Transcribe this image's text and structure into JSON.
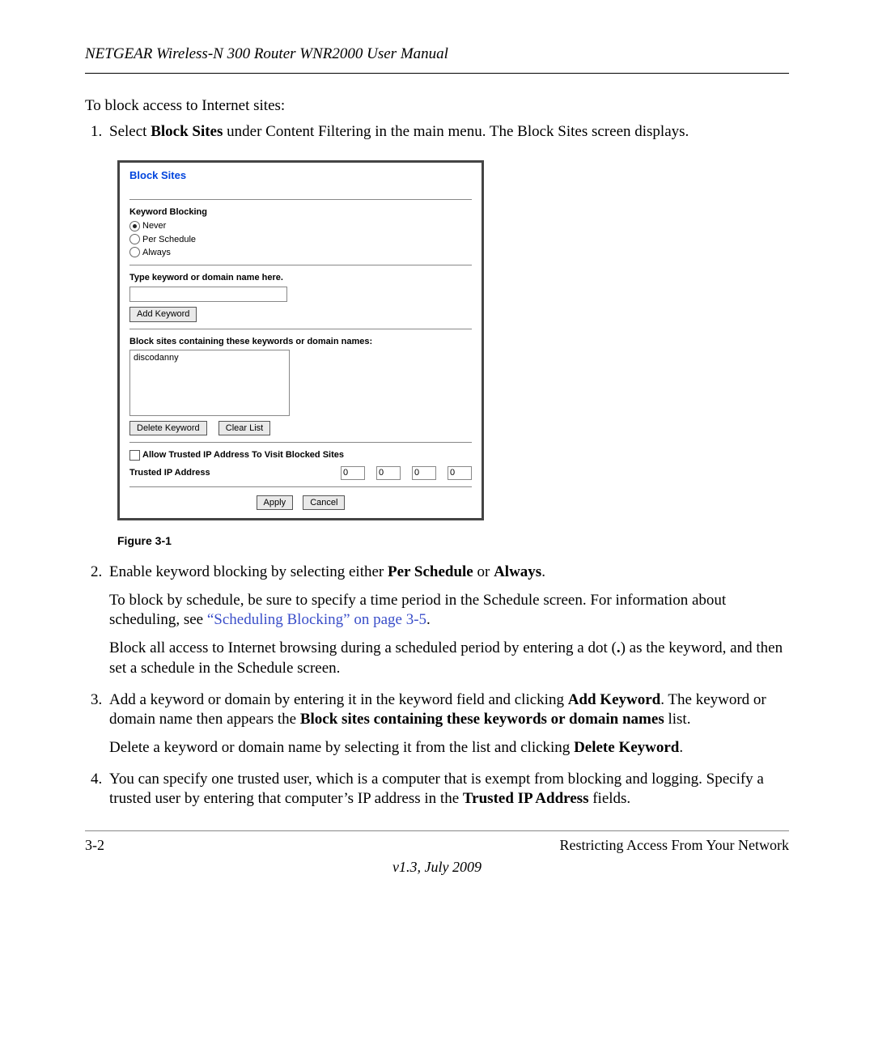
{
  "header": "NETGEAR Wireless-N 300 Router WNR2000 User Manual",
  "intro": "To block access to Internet sites:",
  "steps": {
    "s1": {
      "pre": "Select ",
      "bold": "Block Sites",
      "post": " under Content Filtering in the main menu. The Block Sites screen displays."
    },
    "s2": {
      "line1_pre": "Enable keyword blocking by selecting either ",
      "line1_b1": "Per Schedule",
      "line1_mid": " or ",
      "line1_b2": "Always",
      "line1_post": ".",
      "p2_pre": "To block by schedule, be sure to specify a time period in the Schedule screen. For information about scheduling, see ",
      "p2_link": "“Scheduling Blocking” on page 3-5",
      "p2_post": ".",
      "p3_pre": "Block all access to Internet browsing during a scheduled period by entering a dot (",
      "p3_dot": ".",
      "p3_post": ") as the keyword, and then set a schedule in the Schedule screen."
    },
    "s3": {
      "p1_pre": "Add a keyword or domain by entering it in the keyword field and clicking ",
      "p1_b1": "Add Keyword",
      "p1_mid": ". The keyword or domain name then appears the ",
      "p1_b2": "Block sites containing these keywords or domain names",
      "p1_post": " list.",
      "p2_pre": "Delete a keyword or domain name by selecting it from the list and clicking ",
      "p2_b1": "Delete Keyword",
      "p2_post": "."
    },
    "s4": {
      "pre": "You can specify one trusted user, which is a computer that is exempt from blocking and logging. Specify a trusted user by entering that computer’s IP address in the ",
      "b1": "Trusted IP Address",
      "post": " fields."
    }
  },
  "screenshot": {
    "title": "Block Sites",
    "kw_label": "Keyword Blocking",
    "opt_never": "Never",
    "opt_sched": "Per Schedule",
    "opt_always": "Always",
    "type_label": "Type keyword or domain name here.",
    "add_kw": "Add Keyword",
    "list_label": "Block sites containing these keywords or domain names:",
    "list_item": "discodanny",
    "del_kw": "Delete Keyword",
    "clear": "Clear List",
    "allow_label": "Allow Trusted IP Address To Visit Blocked Sites",
    "trusted_label": "Trusted IP Address",
    "ip": [
      "0",
      "0",
      "0",
      "0"
    ],
    "apply": "Apply",
    "cancel": "Cancel"
  },
  "figcap": "Figure 3-1",
  "footer": {
    "left": "3-2",
    "right": "Restricting Access From Your Network",
    "ver": "v1.3, July 2009"
  }
}
